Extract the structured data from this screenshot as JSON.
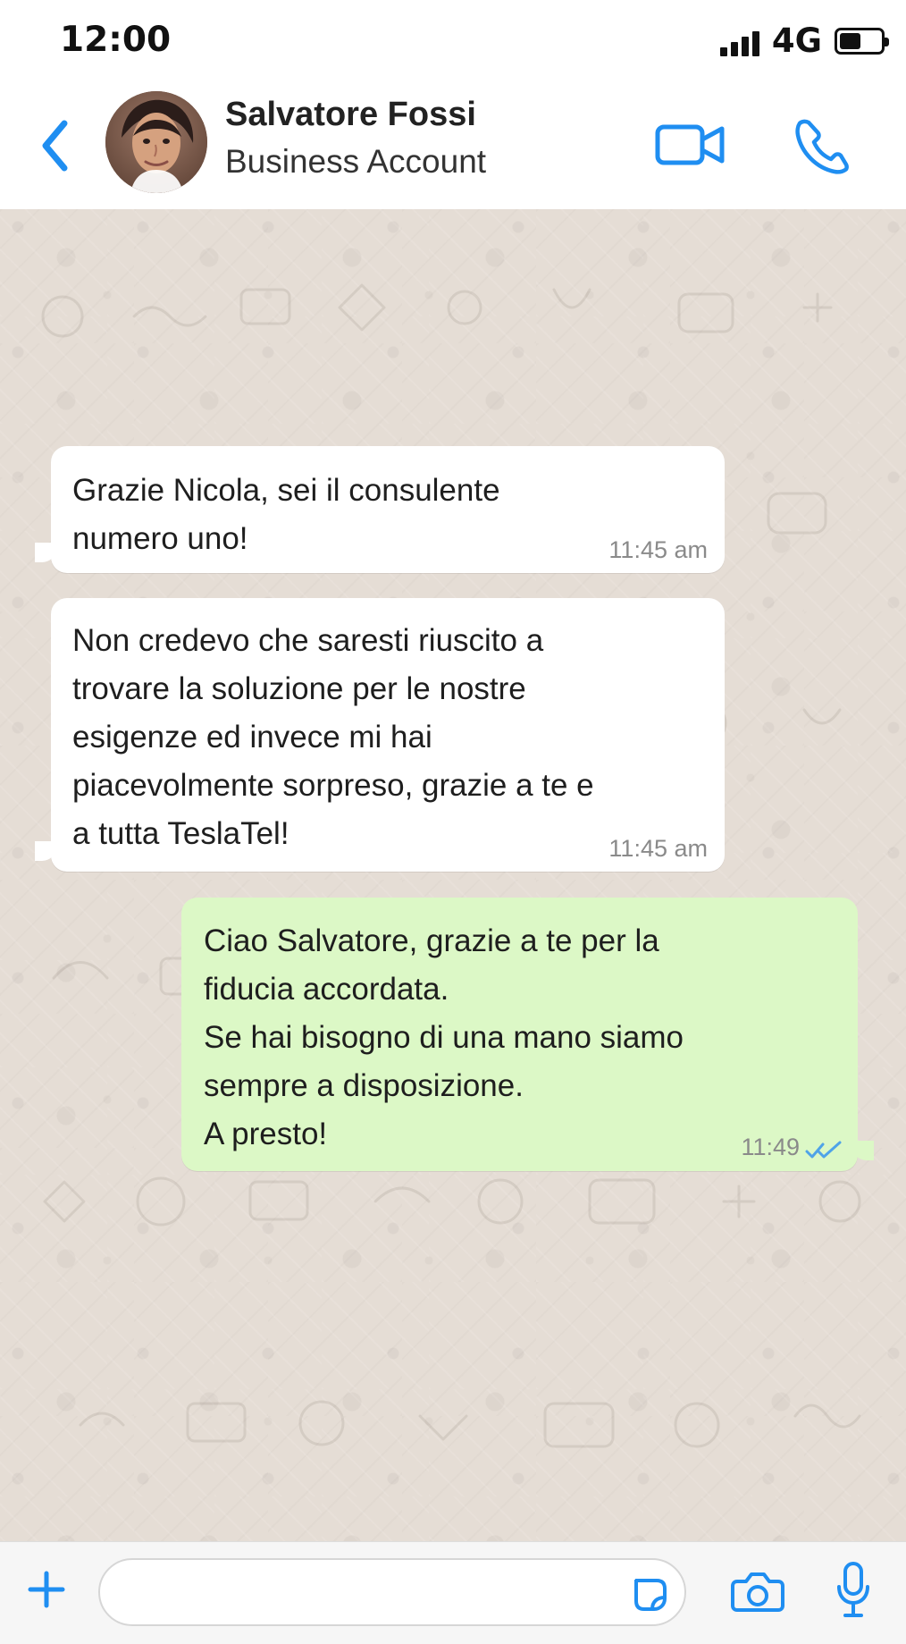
{
  "status_bar": {
    "time": "12:00",
    "network": "4G",
    "signal_icon": "signal-icon",
    "battery_icon": "battery-icon"
  },
  "header": {
    "back_icon": "chevron-left-icon",
    "contact_name": "Salvatore Fossi",
    "contact_subtitle": "Business Account",
    "video_icon": "video-camera-icon",
    "voice_icon": "phone-icon"
  },
  "chat": {
    "messages": [
      {
        "direction": "incoming",
        "text": "Grazie Nicola, sei il consulente\nnumero uno!",
        "time": "11:45 am"
      },
      {
        "direction": "incoming",
        "text": "Non credevo che saresti riuscito a\ntrovare la soluzione per le nostre\nesigenze ed invece mi hai\npiacevolmente sorpreso, grazie a te e\na tutta TeslaTel!",
        "time": "11:45 am"
      },
      {
        "direction": "outgoing",
        "text": "Ciao Salvatore, grazie a te per la\nfiducia accordata.\nSe hai bisogno di una mano siamo\nsempre a disposizione.\nA presto!",
        "time": "11:49",
        "status_icon": "double-check-icon"
      }
    ]
  },
  "composer": {
    "plus_icon": "plus-icon",
    "input_value": "",
    "sticker_icon": "sticker-icon",
    "camera_icon": "camera-icon",
    "mic_icon": "microphone-icon"
  },
  "colors": {
    "accent": "#1f8ef1",
    "incoming_bubble": "#ffffff",
    "outgoing_bubble": "#dcf8c6",
    "chat_background": "#e5ddd5"
  }
}
